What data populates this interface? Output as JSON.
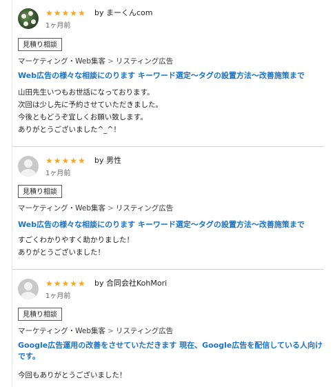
{
  "reviews": [
    {
      "avatar": "user-photo",
      "rating": 5,
      "stars": "★★★★★",
      "by": "by まーくんcom",
      "time_ago": "1ヶ月前",
      "tag": "見積り相談",
      "category": {
        "parent": "マーケティング・Web集客",
        "separator": ">",
        "child": "リスティング広告"
      },
      "service_title": "Web広告の様々な相談にのります キーワード選定〜タグの設置方法〜改善施策まで",
      "comment": "山田先生いつもお世話になっております。\n次回は少し先に予約させていただきました。\n今後ともどうぞ宜しくお願い致します。\nありがとうございました^_^！"
    },
    {
      "avatar": "default-avatar",
      "rating": 5,
      "stars": "★★★★★",
      "by": "by 男性",
      "time_ago": "1ヶ月前",
      "tag": "見積り相談",
      "category": {
        "parent": "マーケティング・Web集客",
        "separator": ">",
        "child": "リスティング広告"
      },
      "service_title": "Web広告の様々な相談にのります キーワード選定〜タグの設置方法〜改善施策まで",
      "comment": "すごくわかりやすく助かりました！\nありがとうございました！"
    },
    {
      "avatar": "default-avatar",
      "rating": 5,
      "stars": "★★★★★",
      "by": "by 合同会社KohMori",
      "time_ago": "1ヶ月前",
      "tag": "見積り相談",
      "category": {
        "parent": "マーケティング・Web集客",
        "separator": ">",
        "child": "リスティング広告"
      },
      "service_title": "Google広告運用の改善をさせていただきます 現在、Google広告を配信している人向けです。",
      "comment": "今回もありがとうございました！"
    }
  ],
  "colors": {
    "star": "#f6a623",
    "link": "#1a73c9",
    "divider": "#d4d4d4",
    "text": "#222222",
    "muted": "#666666"
  }
}
